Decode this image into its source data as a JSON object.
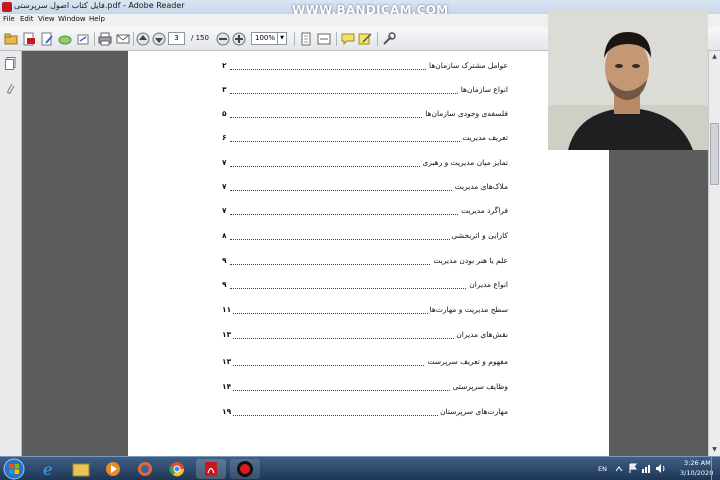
{
  "window": {
    "title": "فایل کتاب اصول سرپرستی.pdf - Adobe Reader",
    "watermark": "WWW.BANDICAM.COM"
  },
  "menu": [
    "File",
    "Edit",
    "View",
    "Window",
    "Help"
  ],
  "toolbar": {
    "current_page": "3",
    "total_pages": "/ 150",
    "zoom": "100%"
  },
  "toc": [
    {
      "title": "عوامل مشترک سازمان‌ها",
      "page": "۲"
    },
    {
      "title": "انواع سازمان‌ها",
      "page": "۳"
    },
    {
      "title": "فلسفه‌ی وجودی سازمان‌ها",
      "page": "۵"
    },
    {
      "title": "تعریف مدیریت",
      "page": "۶"
    },
    {
      "title": "تمایز میان مدیریت و رهبری",
      "page": "۷"
    },
    {
      "title": "ملاک‌های مدیریت",
      "page": "۷"
    },
    {
      "title": "فراگرد مدیریت",
      "page": "۷"
    },
    {
      "title": "کارایی و اثربخشی",
      "page": "۸"
    },
    {
      "title": "علم یا هنر بودن مدیریت",
      "page": "۹"
    },
    {
      "title": "انواع مدیران",
      "page": "۹"
    },
    {
      "title": "سطح مدیریت و مهارت‌ها",
      "page": "۱۱"
    },
    {
      "title": "نقش‌های مدیران",
      "page": "۱۳"
    },
    {
      "title": "مفهوم و تعریف سرپرست",
      "page": "۱۳"
    },
    {
      "title": "وظایف سرپرستی",
      "page": "۱۴"
    },
    {
      "title": "مهارت‌های سرپرستان",
      "page": "۱۹"
    }
  ],
  "tray": {
    "language": "EN",
    "time": "3:26 AM",
    "date": "3/10/2020"
  },
  "colors": {
    "taskbar": "#1e3656",
    "doc_background": "#5c5c5c",
    "page": "#ffffff"
  }
}
